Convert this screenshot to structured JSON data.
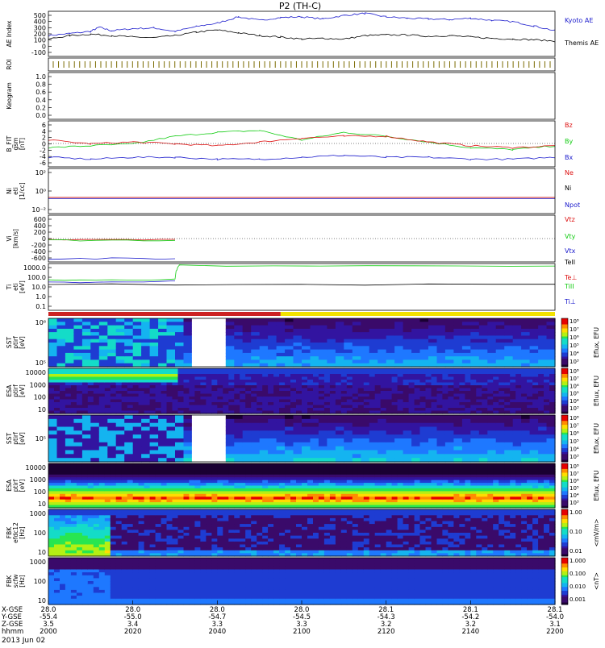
{
  "title": "P2 (TH-C)",
  "date_label": "2013 Jun 02",
  "colors": {
    "blue": "#1a1acc",
    "black": "#000000",
    "red": "#dd1111",
    "green": "#11cc11",
    "yellow": "#f2e200",
    "darkred": "#cc2222"
  },
  "panels": [
    {
      "key": "ae",
      "ylabel": [
        "AE Index"
      ],
      "ticks": [
        "500",
        "400",
        "300",
        "200",
        "100",
        "0",
        "-100"
      ]
    },
    {
      "key": "roi",
      "ylabel": [
        "ROI"
      ],
      "ticks": []
    },
    {
      "key": "keo",
      "ylabel": [
        "Keogram"
      ],
      "ticks": [
        "1.0",
        "0.8",
        "0.6",
        "0.4",
        "0.2",
        "0.0"
      ]
    },
    {
      "key": "bfit",
      "ylabel": [
        "B_FIT",
        "gsm",
        "[nT]"
      ],
      "ticks": [
        "6",
        "4",
        "2",
        "0",
        "-2",
        "-4",
        "-6"
      ]
    },
    {
      "key": "ni",
      "ylabel": [
        "Ni",
        "eti",
        "[1/cc]"
      ],
      "ticks": [
        "10²",
        "10⁰",
        "10⁻²"
      ]
    },
    {
      "key": "vi",
      "ylabel": [
        "Vi",
        "[km/s]"
      ],
      "ticks": [
        "600",
        "400",
        "200",
        "0",
        "-200",
        "-400",
        "-600"
      ]
    },
    {
      "key": "ti",
      "ylabel": [
        "Ti",
        "eti",
        "[eV]"
      ],
      "ticks": [
        "1000.0",
        "100.0",
        "10.0",
        "1.0",
        "0.1"
      ]
    },
    {
      "key": "sst1",
      "ylabel": [
        "SST",
        "ptirf",
        "[eV]"
      ],
      "ticks": [
        "10⁶",
        "10⁵"
      ]
    },
    {
      "key": "esa1",
      "ylabel": [
        "ESA",
        "ptirf",
        "[eV]"
      ],
      "ticks": [
        "10000",
        "1000",
        "100",
        "10"
      ]
    },
    {
      "key": "sst2",
      "ylabel": [
        "SST",
        "ptirf",
        "[eV]"
      ],
      "ticks": [
        "10⁵"
      ]
    },
    {
      "key": "esa2",
      "ylabel": [
        "ESA",
        "ptirf",
        "[eV]"
      ],
      "ticks": [
        "10000",
        "1000",
        "100",
        "10"
      ]
    },
    {
      "key": "fbk1",
      "ylabel": [
        "FBK",
        "efdc12",
        "[Hz]"
      ],
      "ticks": [
        "1000",
        "100",
        "10"
      ]
    },
    {
      "key": "fbk2",
      "ylabel": [
        "FBK",
        "scfw",
        "[Hz]"
      ],
      "ticks": [
        "1000",
        "100",
        "10"
      ]
    }
  ],
  "legends": {
    "ae": [
      "Kyoto AE",
      "Themis AE"
    ],
    "bfit": [
      "Bz",
      "By",
      "Bx"
    ],
    "ni": [
      "Ne",
      "Ni",
      "Npot"
    ],
    "vi": [
      "Vtz",
      "Vty",
      "Vtx"
    ],
    "ti": [
      "TeII",
      "Te⊥",
      "TiII",
      "Ti⊥"
    ]
  },
  "colorbars": [
    {
      "label": "Eflux, EFU",
      "ticks": [
        "10⁸",
        "10⁷",
        "10⁶",
        "10⁵",
        "10⁴",
        "10³"
      ]
    },
    {
      "label": "Eflux, EFU",
      "ticks": [
        "10⁸",
        "10⁷",
        "10⁶",
        "10⁵",
        "10⁴",
        "10³"
      ]
    },
    {
      "label": "Eflux, EFU",
      "ticks": [
        "10⁸",
        "10⁷",
        "10⁶",
        "10⁵",
        "10⁴",
        "10³"
      ]
    },
    {
      "label": "Eflux, EFU",
      "ticks": [
        "10⁸",
        "10⁷",
        "10⁶",
        "10⁵",
        "10⁴",
        "10³"
      ]
    },
    {
      "label": "<mV/m>",
      "ticks": [
        "1.00",
        "0.10",
        "0.01"
      ]
    },
    {
      "label": "<nT>",
      "ticks": [
        "1.000",
        "0.100",
        "0.010",
        "0.001"
      ]
    }
  ],
  "footer": {
    "row_labels": [
      "X-GSE",
      "Y-GSE",
      "Z-GSE",
      "hhmm"
    ],
    "columns": [
      {
        "x": "28.0",
        "y": "-55.4",
        "z": "3.5",
        "t": "2000"
      },
      {
        "x": "28.0",
        "y": "-55.0",
        "z": "3.4",
        "t": "2020"
      },
      {
        "x": "28.0",
        "y": "-54.7",
        "z": "3.3",
        "t": "2040"
      },
      {
        "x": "28.0",
        "y": "-54.5",
        "z": "3.3",
        "t": "2100"
      },
      {
        "x": "28.1",
        "y": "-54.3",
        "z": "3.2",
        "t": "2120"
      },
      {
        "x": "28.1",
        "y": "-54.2",
        "z": "3.2",
        "t": "2140"
      },
      {
        "x": "28.1",
        "y": "-54.0",
        "z": "3.1",
        "t": "2200"
      }
    ]
  },
  "chart_data": {
    "type": "line",
    "x_unit": "hhmm",
    "xlim": [
      "2000",
      "2200"
    ],
    "xticks": [
      "2000",
      "2020",
      "2040",
      "2100",
      "2120",
      "2140",
      "2200"
    ],
    "panels": [
      {
        "name": "AE Index",
        "ylim": [
          -100,
          550
        ],
        "series": [
          {
            "name": "Kyoto AE",
            "t": [
              0,
              5,
              10,
              12,
              15,
              20,
              25,
              30,
              35,
              40,
              45,
              50,
              55,
              60,
              65,
              70,
              75,
              80,
              85,
              90,
              95,
              100,
              105,
              110,
              115,
              120
            ],
            "values": [
              200,
              230,
              260,
              320,
              270,
              300,
              310,
              260,
              330,
              380,
              470,
              420,
              460,
              470,
              440,
              490,
              520,
              470,
              450,
              440,
              430,
              450,
              420,
              400,
              340,
              270
            ]
          },
          {
            "name": "Themis AE",
            "t": [
              0,
              5,
              10,
              15,
              20,
              25,
              30,
              35,
              40,
              45,
              50,
              55,
              60,
              65,
              70,
              75,
              80,
              85,
              90,
              95,
              100,
              105,
              110,
              115,
              120
            ],
            "values": [
              150,
              200,
              220,
              200,
              180,
              170,
              200,
              250,
              280,
              240,
              200,
              180,
              150,
              160,
              150,
              200,
              210,
              210,
              190,
              200,
              180,
              160,
              150,
              140,
              120
            ]
          }
        ]
      },
      {
        "name": "B_FIT gsm",
        "ylim": [
          -6,
          6
        ],
        "series": [
          {
            "name": "Bz",
            "t": [
              0,
              10,
              20,
              30,
              40,
              50,
              60,
              70,
              80,
              90,
              100,
              110,
              120
            ],
            "values": [
              1.0,
              0.0,
              0.5,
              0.0,
              -0.5,
              0.5,
              1.5,
              2.0,
              2.0,
              0.5,
              -0.5,
              -1.0,
              -0.5
            ]
          },
          {
            "name": "By",
            "t": [
              0,
              10,
              20,
              30,
              40,
              50,
              60,
              70,
              80,
              90,
              100,
              110,
              120
            ],
            "values": [
              -1.0,
              -0.5,
              0.0,
              2.0,
              3.0,
              3.5,
              1.0,
              3.0,
              2.0,
              0.5,
              -1.0,
              -1.5,
              -0.5
            ]
          },
          {
            "name": "Bx",
            "t": [
              0,
              10,
              20,
              30,
              40,
              50,
              60,
              70,
              80,
              90,
              100,
              110,
              120
            ],
            "values": [
              -3.5,
              -4.0,
              -3.5,
              -3.5,
              -4.0,
              -4.0,
              -3.5,
              -3.0,
              -3.5,
              -3.5,
              -4.0,
              -4.0,
              -3.5
            ]
          }
        ]
      },
      {
        "name": "Vi",
        "ylim": [
          -700,
          700
        ],
        "series": [
          {
            "name": "Vtz",
            "t": [
              0,
              30
            ],
            "values": [
              -20,
              -20
            ]
          },
          {
            "name": "Vty",
            "t": [
              0,
              30
            ],
            "values": [
              -50,
              -50
            ]
          },
          {
            "name": "Vtx",
            "t": [
              0,
              30
            ],
            "values": [
              -600,
              -600
            ]
          }
        ]
      },
      {
        "name": "Ti",
        "ylim": [
          0.1,
          1500
        ],
        "yscale": "log",
        "series": [
          {
            "name": "TeII",
            "t": [
              0,
              120
            ],
            "values": [
              20,
              20
            ]
          },
          {
            "name": "Te⊥",
            "t": [
              0,
              30,
              31,
              120
            ],
            "values": [
              50,
              60,
              1000,
              1000
            ]
          },
          {
            "name": "TiII",
            "t": [
              0,
              30
            ],
            "values": [
              30,
              40
            ]
          }
        ]
      }
    ]
  }
}
